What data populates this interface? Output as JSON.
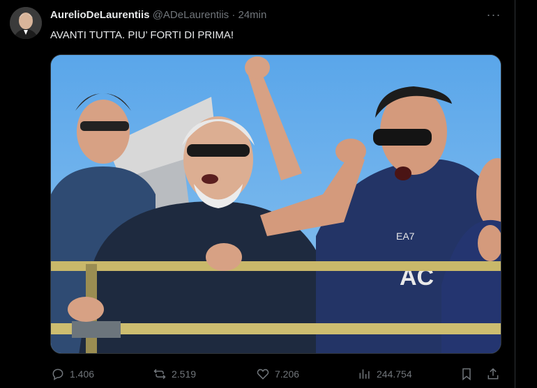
{
  "tweet": {
    "author_name": "AurelioDeLaurentiis",
    "handle": "@ADeLaurentiis",
    "separator": "·",
    "time": "24min",
    "text": "AVANTI TUTTA. PIU’ FORTI DI PRIMA!",
    "more_icon": "more-horizontal-icon"
  },
  "actions": {
    "replies": "1.406",
    "reposts": "2.519",
    "likes": "7.206",
    "views": "244.754",
    "icons": [
      "reply-icon",
      "repost-icon",
      "like-icon",
      "views-icon",
      "bookmark-icon",
      "share-icon"
    ]
  },
  "colors": {
    "background": "#000000",
    "text": "#e7e9ea",
    "muted": "#71767b",
    "border": "#2f3336",
    "sky": "#5fa8e8"
  }
}
